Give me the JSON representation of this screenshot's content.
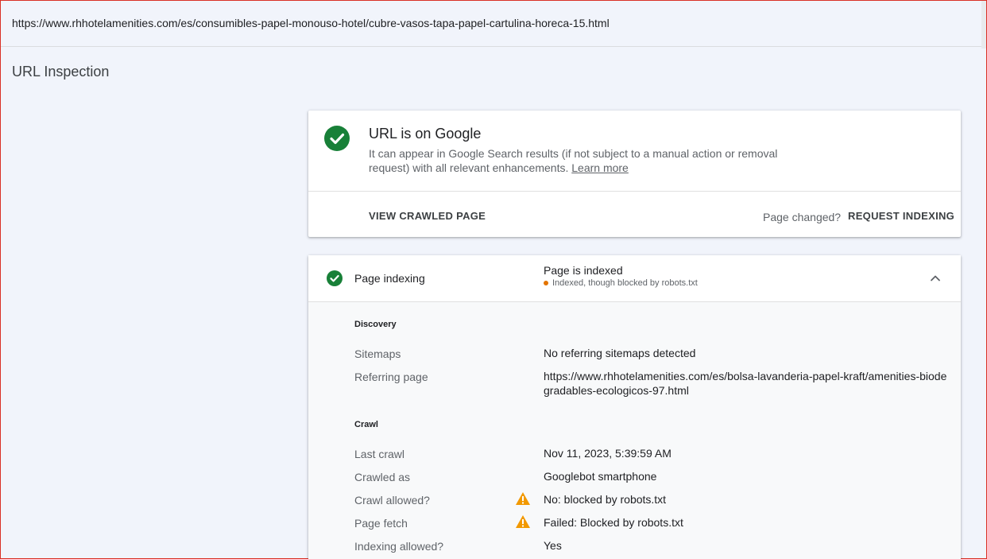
{
  "url_bar": {
    "url": "https://www.rhhotelamenities.com/es/consumibles-papel-monouso-hotel/cubre-vasos-tapa-papel-cartulina-horeca-15.html"
  },
  "page_title": "URL Inspection",
  "status_card": {
    "title": "URL is on Google",
    "description": "It can appear in Google Search results (if not subject to a manual action or removal request) with all relevant enhancements.",
    "learn_more": "Learn more",
    "view_crawled_page": "VIEW CRAWLED PAGE",
    "page_changed": "Page changed?",
    "request_indexing": "REQUEST INDEXING"
  },
  "indexing_card": {
    "label": "Page indexing",
    "status": "Page is indexed",
    "sub_status": "Indexed, though blocked by robots.txt",
    "discovery": {
      "heading": "Discovery",
      "sitemaps_label": "Sitemaps",
      "sitemaps_value": "No referring sitemaps detected",
      "referring_label": "Referring page",
      "referring_value_line1": "https://www.rhhotelamenities.com/es/bolsa-lavanderia-papel-kraft/amenities-biode",
      "referring_value_line2": "gradables-ecologicos-97.html"
    },
    "crawl": {
      "heading": "Crawl",
      "last_crawl_label": "Last crawl",
      "last_crawl_value": "Nov 11, 2023, 5:39:59 AM",
      "crawled_as_label": "Crawled as",
      "crawled_as_value": "Googlebot smartphone",
      "crawl_allowed_label": "Crawl allowed?",
      "crawl_allowed_value": "No: blocked by robots.txt",
      "page_fetch_label": "Page fetch",
      "page_fetch_value": "Failed: Blocked by robots.txt",
      "indexing_allowed_label": "Indexing allowed?",
      "indexing_allowed_value": "Yes"
    }
  },
  "colors": {
    "success": "#188038",
    "warning": "#f29900",
    "sub_dot": "#e37400",
    "background": "#f1f4fb"
  },
  "icons": {
    "status": "check-circle-icon",
    "warning": "warning-triangle-icon",
    "collapse": "chevron-up-icon"
  }
}
